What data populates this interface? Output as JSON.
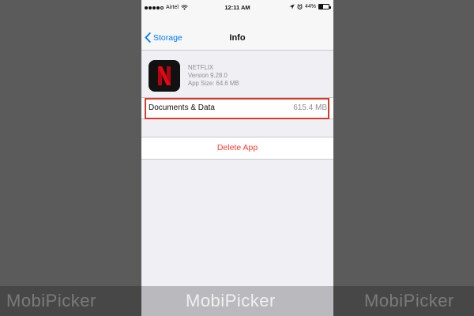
{
  "status_bar": {
    "carrier": "Airtel",
    "time": "12:11 AM",
    "battery": "44%",
    "signal_bars_filled": 4,
    "signal_bars_total": 5,
    "battery_level": 0.44
  },
  "nav": {
    "back_label": "Storage",
    "title": "Info"
  },
  "app": {
    "name": "NETFLIX",
    "version": "Version 9.28.0",
    "app_size": "App Size: 64.6 MB",
    "icon": "netflix-logo",
    "icon_color": "#e50914"
  },
  "documents_data": {
    "label": "Documents & Data",
    "value": "615.4 MB"
  },
  "delete": {
    "label": "Delete App"
  },
  "watermark": {
    "text": "MobiPicker"
  },
  "colors": {
    "accent": "#007aff",
    "destructive": "#ff3b30",
    "highlight": "#d93a2a"
  }
}
